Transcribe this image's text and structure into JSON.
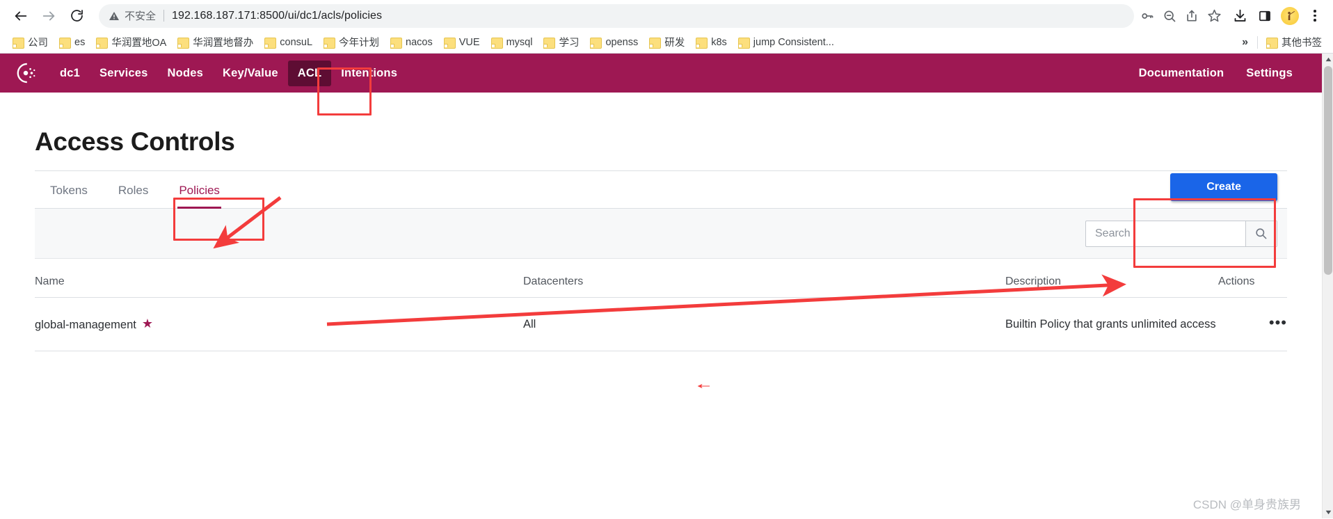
{
  "browser": {
    "back_label": "Back",
    "forward_label": "Forward",
    "reload_label": "Reload",
    "security_label": "不安全",
    "url": "192.168.187.171:8500/ui/dc1/acls/policies",
    "omnibox_icons": [
      "key-icon",
      "zoom-out-icon",
      "share-icon",
      "bookmark-star-icon"
    ],
    "toolbar_icons": [
      "download-icon",
      "side-panel-icon",
      "profile-avatar",
      "chrome-menu-icon"
    ]
  },
  "bookmarks": {
    "items": [
      {
        "label": "公司"
      },
      {
        "label": "es"
      },
      {
        "label": "华润置地OA"
      },
      {
        "label": "华润置地督办"
      },
      {
        "label": "consuL"
      },
      {
        "label": "今年计划"
      },
      {
        "label": "nacos"
      },
      {
        "label": "VUE"
      },
      {
        "label": "mysql"
      },
      {
        "label": "学习"
      },
      {
        "label": "openss"
      },
      {
        "label": "研发"
      },
      {
        "label": "k8s"
      },
      {
        "label": "jump Consistent..."
      }
    ],
    "overflow_label": "»",
    "other_label": "其他书签"
  },
  "consul_nav": {
    "brand": "consul-logo",
    "links": [
      {
        "label": "dc1",
        "active": false
      },
      {
        "label": "Services",
        "active": false
      },
      {
        "label": "Nodes",
        "active": false
      },
      {
        "label": "Key/Value",
        "active": false
      },
      {
        "label": "ACL",
        "active": true
      },
      {
        "label": "Intentions",
        "active": false
      }
    ],
    "right_links": [
      {
        "label": "Documentation"
      },
      {
        "label": "Settings"
      }
    ],
    "bg_color": "#9e1853",
    "active_bg_color": "#5e0d33"
  },
  "main": {
    "title": "Access Controls",
    "tabs": [
      {
        "label": "Tokens",
        "active": false
      },
      {
        "label": "Roles",
        "active": false
      },
      {
        "label": "Policies",
        "active": true
      }
    ],
    "create_label": "Create",
    "create_color": "#1a65e8",
    "search": {
      "value": "",
      "placeholder": "Search",
      "icon": "search-icon"
    },
    "table": {
      "headers": [
        "Name",
        "Datacenters",
        "Description",
        "Actions"
      ],
      "rows": [
        {
          "name": "global-management",
          "starred": true,
          "star_glyph": "★",
          "datacenters": "All",
          "description": "Builtin Policy that grants unlimited access",
          "actions_glyph": "•••"
        }
      ]
    }
  },
  "annotations": {
    "color": "#f33c3c",
    "boxes": [
      "acl-nav-item",
      "policies-tab",
      "create-button"
    ],
    "arrows": [
      "arrow-to-access-controls",
      "arrow-to-create-button"
    ]
  },
  "watermark": "CSDN @单身贵族男"
}
